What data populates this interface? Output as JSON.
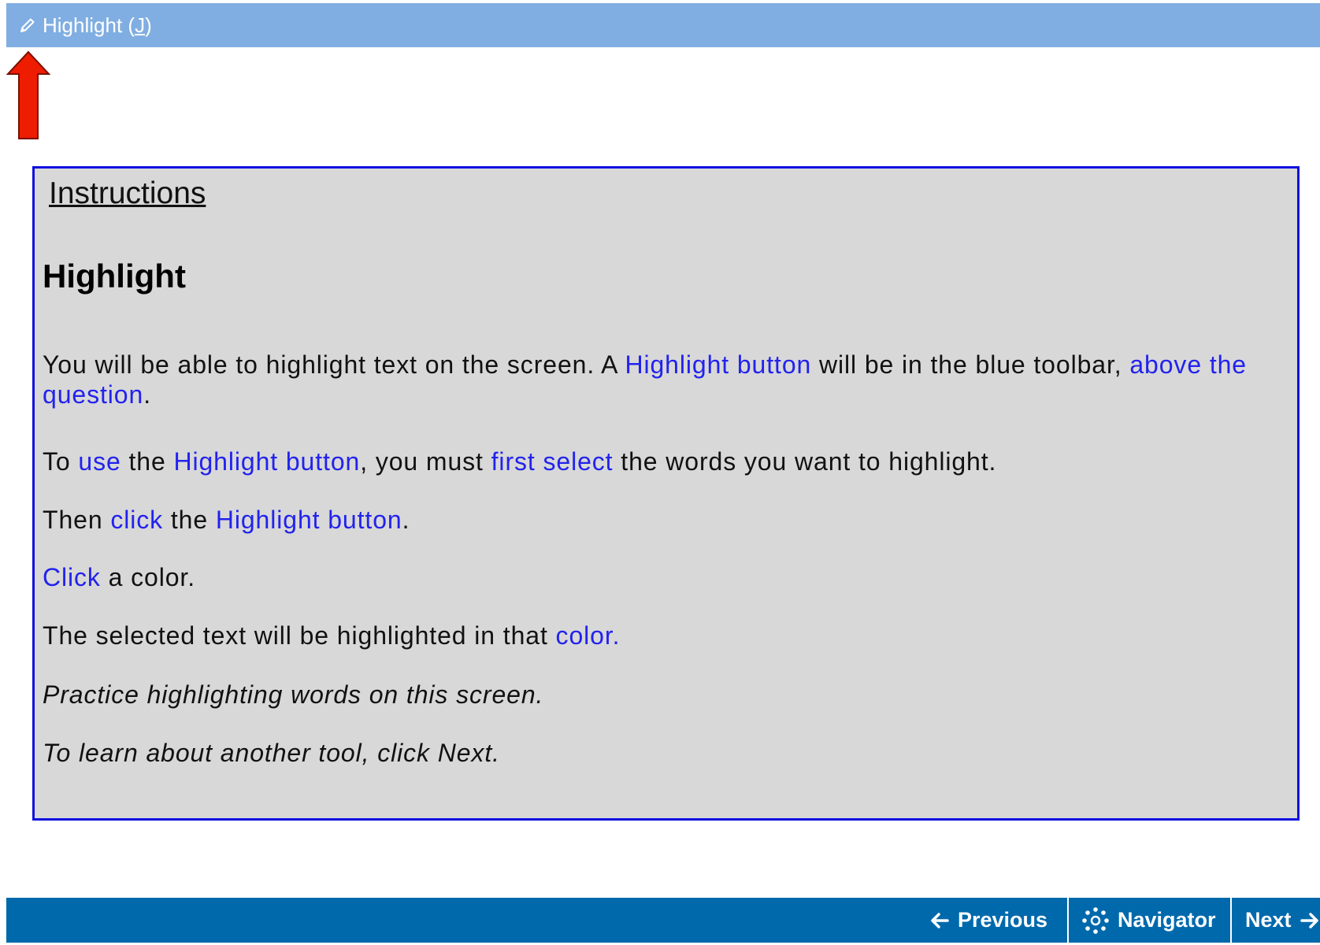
{
  "toolbar": {
    "highlight_label": "Highlight (",
    "highlight_key": "J",
    "highlight_close": ")",
    "icon": "pencil-icon",
    "background": "#80aee2"
  },
  "instructions": {
    "title": "Instructions",
    "heading": "Highlight",
    "p1": {
      "a": "You will be able to highlight text on the screen. A ",
      "b": "Highlight button",
      "c": " will be in the blue toolbar, ",
      "d": "above the question",
      "e": "."
    },
    "p2": {
      "a": "To ",
      "b": "use",
      "c": " the ",
      "d": "Highlight button",
      "e": ", you must ",
      "f": "first select",
      "g": " the words you want to highlight."
    },
    "p3": {
      "a": "Then ",
      "b": "click",
      "c": " the ",
      "d": "Highlight button",
      "e": "."
    },
    "p4": {
      "a": "Click",
      "b": " a color."
    },
    "p5": {
      "a": "The selected text will be highlighted in that ",
      "b": "color",
      "c": "."
    },
    "p6": "Practice highlighting words on this screen.",
    "p7": "To learn about another tool, click Next."
  },
  "nav": {
    "previous": "Previous",
    "navigator": "Navigator",
    "next": "Next"
  },
  "colors": {
    "toolbar": "#80aee2",
    "bottom_bar": "#0069ac",
    "box_border": "#1010e0",
    "box_background": "#d8d8d8",
    "link_text": "#2222ee",
    "arrow": "#ee1c00"
  }
}
